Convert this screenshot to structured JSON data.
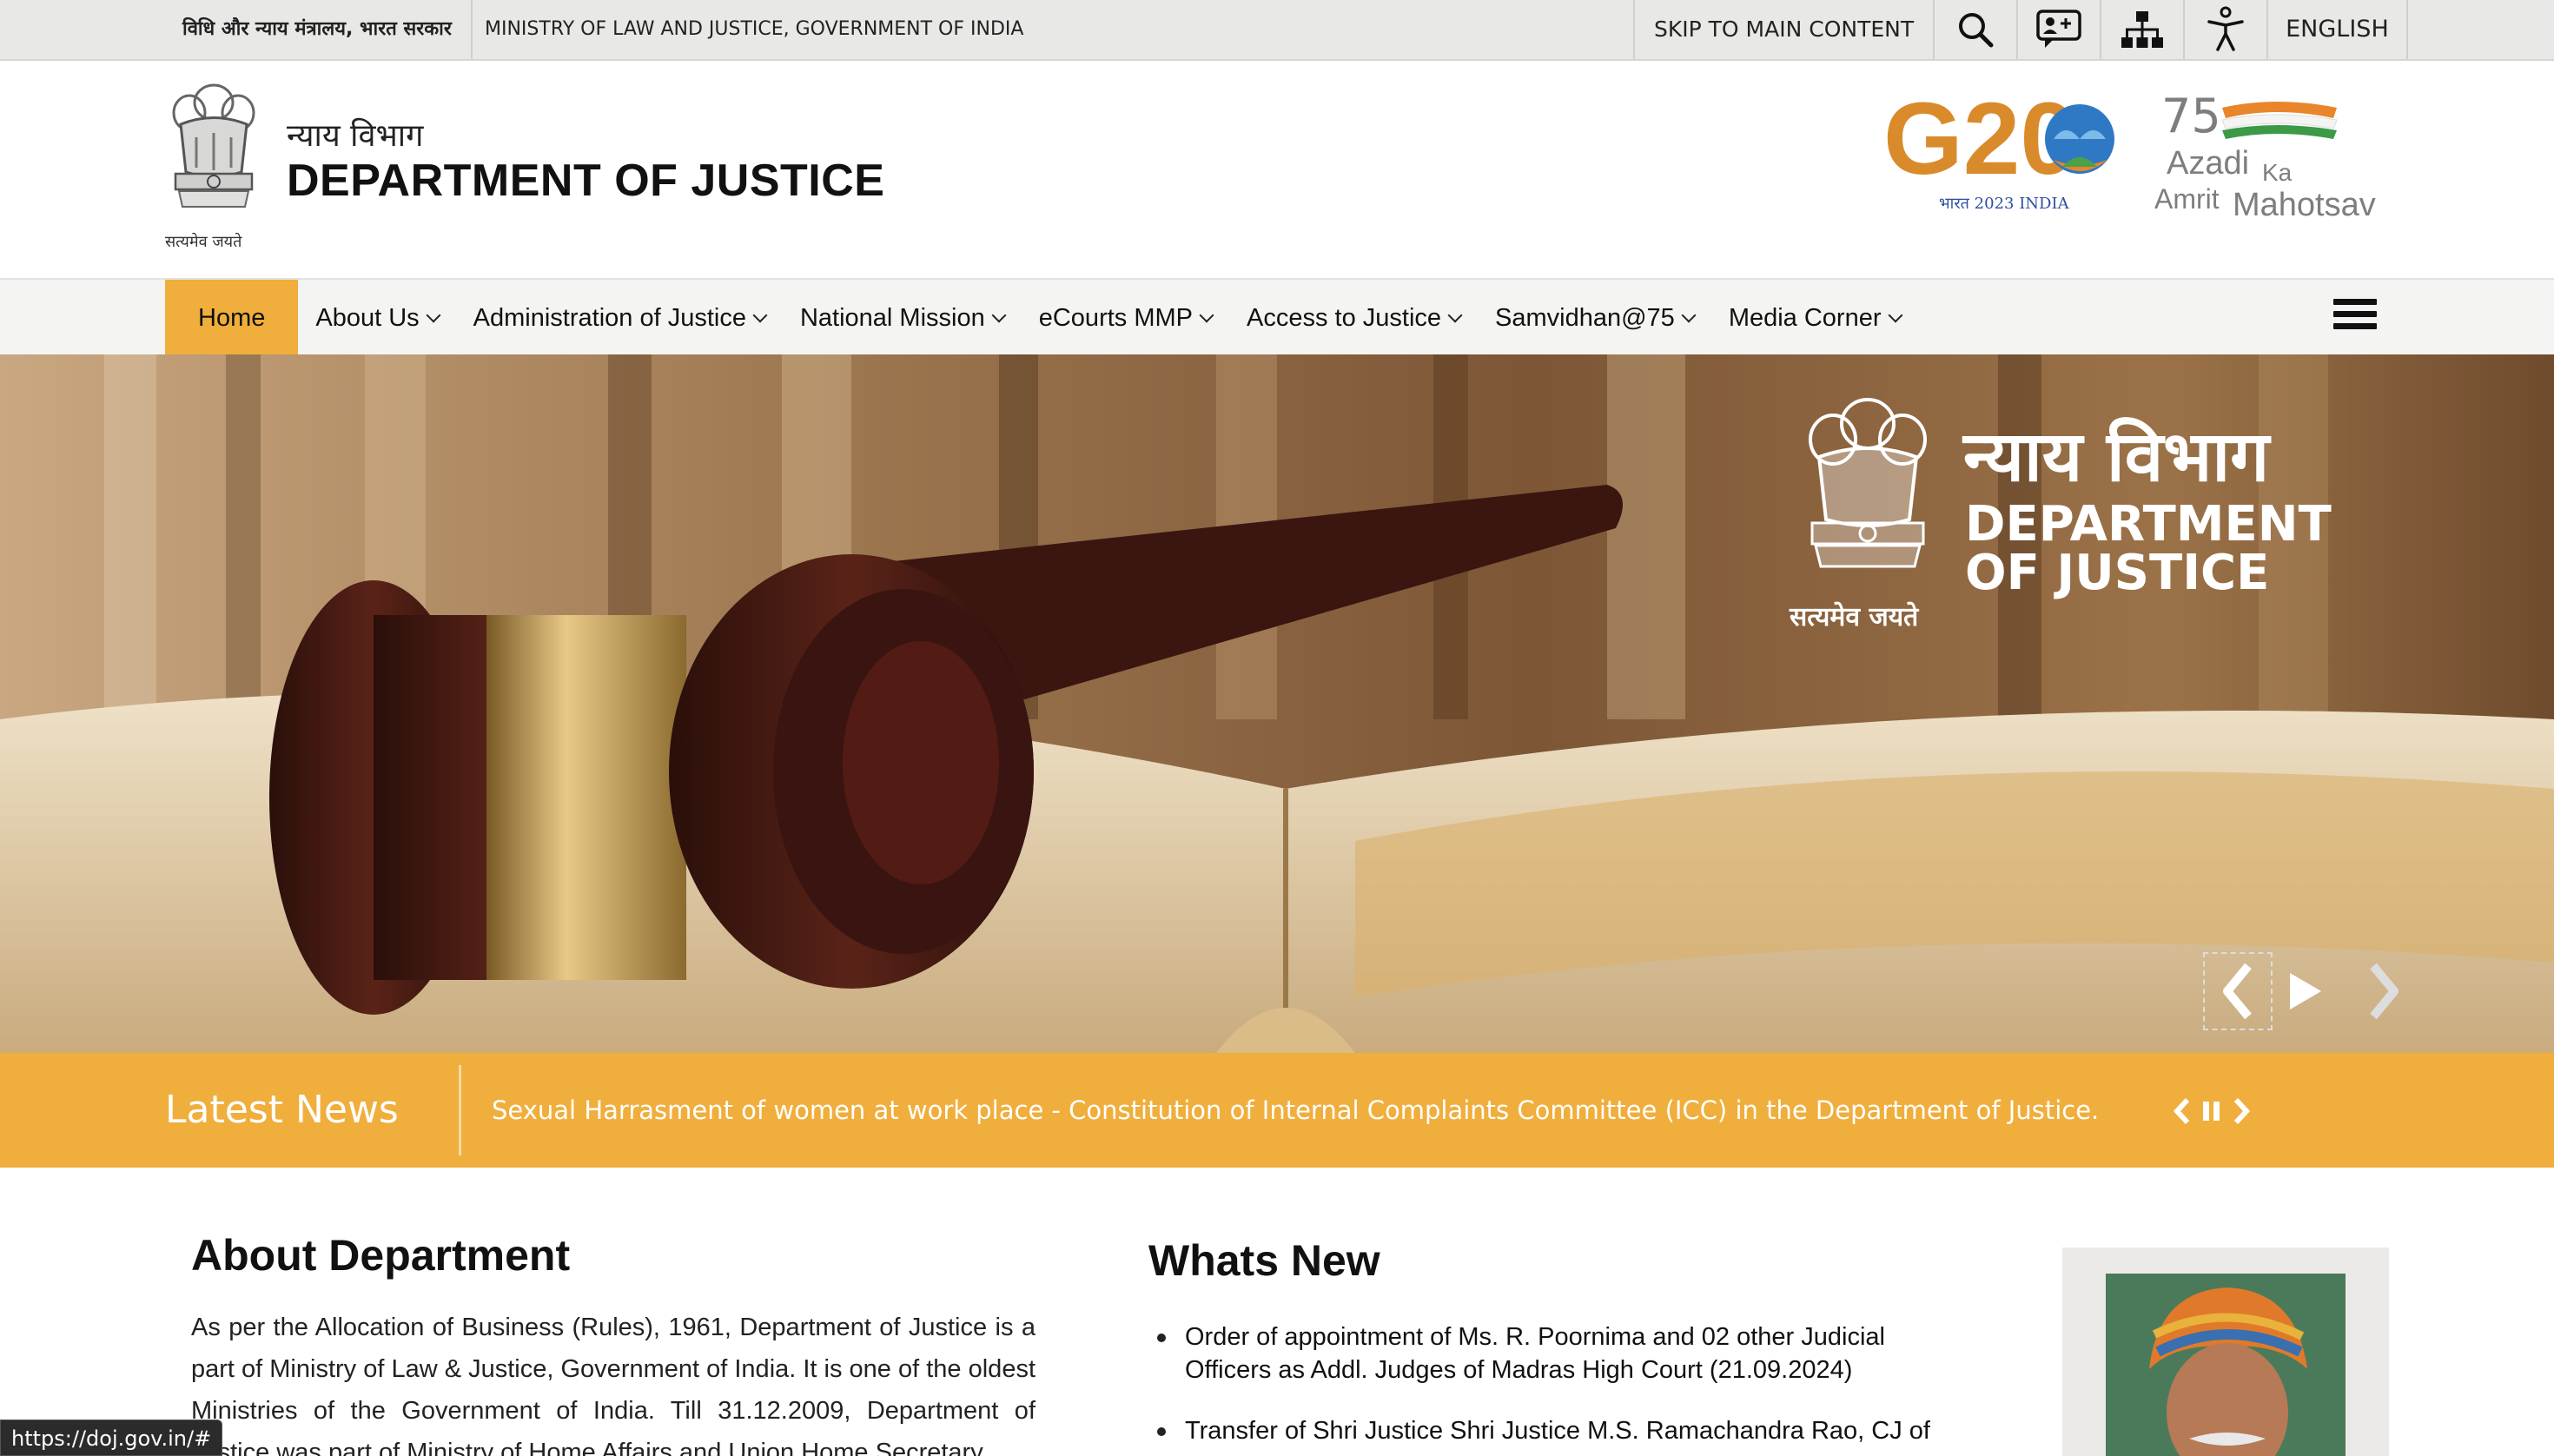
{
  "topbar": {
    "hindi_ministry": "विधि और न्याय मंत्रालय, भारत सरकार",
    "english_ministry": "MINISTRY OF LAW AND JUSTICE, GOVERNMENT OF INDIA",
    "skip_link": "SKIP TO MAIN CONTENT",
    "icons": [
      "search-icon",
      "feedback-chat-icon",
      "sitemap-icon",
      "accessibility-icon"
    ],
    "language": "ENGLISH"
  },
  "header": {
    "emblem_caption": "सत्यमेव जयते",
    "dept_hindi": "न्याय विभाग",
    "dept_english": "DEPARTMENT OF JUSTICE",
    "g20_logo_text": "G20",
    "g20_sub": "भारत 2023 INDIA",
    "azadi_line1": "Azadi",
    "azadi_ka": "Ka",
    "azadi_line2": "Amrit",
    "azadi_line3": "Mahotsav",
    "azadi_number": "75"
  },
  "nav": {
    "items": [
      {
        "label": "Home",
        "active": true,
        "dropdown": false
      },
      {
        "label": "About Us",
        "active": false,
        "dropdown": true
      },
      {
        "label": "Administration of Justice",
        "active": false,
        "dropdown": true
      },
      {
        "label": "National Mission",
        "active": false,
        "dropdown": true
      },
      {
        "label": "eCourts MMP",
        "active": false,
        "dropdown": true
      },
      {
        "label": "Access to Justice",
        "active": false,
        "dropdown": true
      },
      {
        "label": "Samvidhan@75",
        "active": false,
        "dropdown": true
      },
      {
        "label": "Media Corner",
        "active": false,
        "dropdown": true
      }
    ],
    "menu_icon": "hamburger-icon"
  },
  "hero": {
    "title_hindi": "न्याय विभाग",
    "title_english_1": "DEPARTMENT",
    "title_english_2": "OF JUSTICE",
    "emblem_caption": "सत्यमेव जयते",
    "controls": [
      "chevron-left-icon",
      "play-icon",
      "chevron-right-icon"
    ]
  },
  "news": {
    "label": "Latest News",
    "headline": "Sexual Harrasment of women at work place - Constitution of Internal Complaints Committee (ICC) in the Department of Justice.",
    "controls": [
      "chevron-left-icon",
      "pause-icon",
      "chevron-right-icon"
    ]
  },
  "about": {
    "title": "About Department",
    "text": "As per the Allocation of Business (Rules), 1961, Department of Justice is a part of Ministry of Law & Justice, Government of India. It is one of the oldest Ministries of the Government of India. Till 31.12.2009, Department of Justice was part of Ministry of Home Affairs and Union Home Secretary"
  },
  "whats_new": {
    "title": "Whats New",
    "items": [
      "Order of appointment of Ms. R. Poornima and 02 other Judicial Officers as Addl. Judges of Madras High Court (21.09.2024)",
      "Transfer of Shri Justice Shri Justice M.S. Ramachandra Rao, CJ of"
    ]
  },
  "statusbar": {
    "url": "https://doj.gov.in/#"
  },
  "colors": {
    "accent": "#f0ae3c",
    "topbar_bg": "#e8e8e6",
    "nav_bg": "#f4f4f2"
  }
}
